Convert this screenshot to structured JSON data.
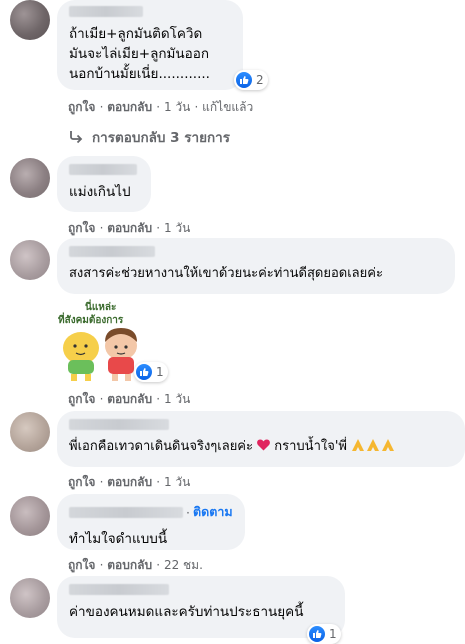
{
  "comments": [
    {
      "text": "ถ้าเมีย+ลูกมันติดโควิด\nมันจะไล่เมีย+ลูกมันออก\nนอกบ้านมั้ยเนี่ย............",
      "reaction_count": "2",
      "actions": {
        "like": "ถูกใจ",
        "reply": "ตอบกลับ",
        "time": "1 วัน",
        "edited": "แก้ไขแล้ว"
      }
    },
    {
      "text": "แม่งเกินไป",
      "actions": {
        "like": "ถูกใจ",
        "reply": "ตอบกลับ",
        "time": "1 วัน"
      }
    },
    {
      "text": "สงสารค่ะช่วยหางานให้เขาด้วยนะค่ะท่านดีสุดยอดเลยค่ะ",
      "sticker_text": "นี่แหล่ะ\nที่สังคมต้องการ",
      "reaction_count": "1",
      "actions": {
        "like": "ถูกใจ",
        "reply": "ตอบกลับ",
        "time": "1 วัน"
      }
    },
    {
      "text": "พี่เอกคือเทวดาเดินดินจริงๆเลยค่ะ",
      "text_tail": "กราบน้ำใจ'พี่",
      "actions": {
        "like": "ถูกใจ",
        "reply": "ตอบกลับ",
        "time": "1 วัน"
      }
    },
    {
      "follow_label": "ติดตาม",
      "text": "ทำไมใจดำแบบนี้",
      "actions": {
        "like": "ถูกใจ",
        "reply": "ตอบกลับ",
        "time": "22 ชม."
      }
    },
    {
      "text": "ค่าของคนหมดและครับท่านประธานยุคนี้",
      "reaction_count": "1"
    }
  ],
  "replies_link": "การตอบกลับ 3 รายการ",
  "colors": {
    "like_blue": "#1877f2",
    "bubble": "#f0f2f5",
    "meta": "#65676b"
  },
  "icons": {
    "reaction": "like-icon",
    "heart": "heart-icon",
    "pray": "pray-icon",
    "reply": "reply-arrow-icon"
  }
}
